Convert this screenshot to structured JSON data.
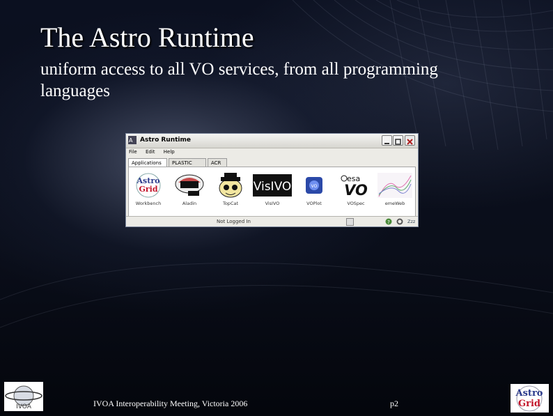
{
  "slide": {
    "title": "The Astro Runtime",
    "subtitle": "uniform access to all VO services, from all programming languages",
    "footer": "IVOA Interoperability Meeting, Victoria 2006",
    "page": "p2"
  },
  "window": {
    "title": "Astro Runtime",
    "menu": [
      "File",
      "Edit",
      "Help"
    ],
    "tabs": [
      "Applications",
      "PLASTIC",
      "ACR"
    ],
    "active_tab": "Applications",
    "apps": [
      {
        "label": "Workbench",
        "icon": "astrogrid-icon"
      },
      {
        "label": "Aladin",
        "icon": "aladin-icon"
      },
      {
        "label": "TopCat",
        "icon": "topcat-icon"
      },
      {
        "label": "VisIVO",
        "icon": "visivo-icon"
      },
      {
        "label": "VOPlot",
        "icon": "voplot-icon"
      },
      {
        "label": "VOSpec",
        "icon": "vospec-icon"
      },
      {
        "label": "emeWeb",
        "icon": "emeweb-icon"
      }
    ],
    "status": "Not Logged In",
    "status_right": "Zzz"
  },
  "logos": {
    "left": "IVOA",
    "right": "Astro Grid"
  },
  "colors": {
    "background": "#0a0e1a",
    "text": "#ffffff",
    "window_chrome": "#ecebe6"
  }
}
